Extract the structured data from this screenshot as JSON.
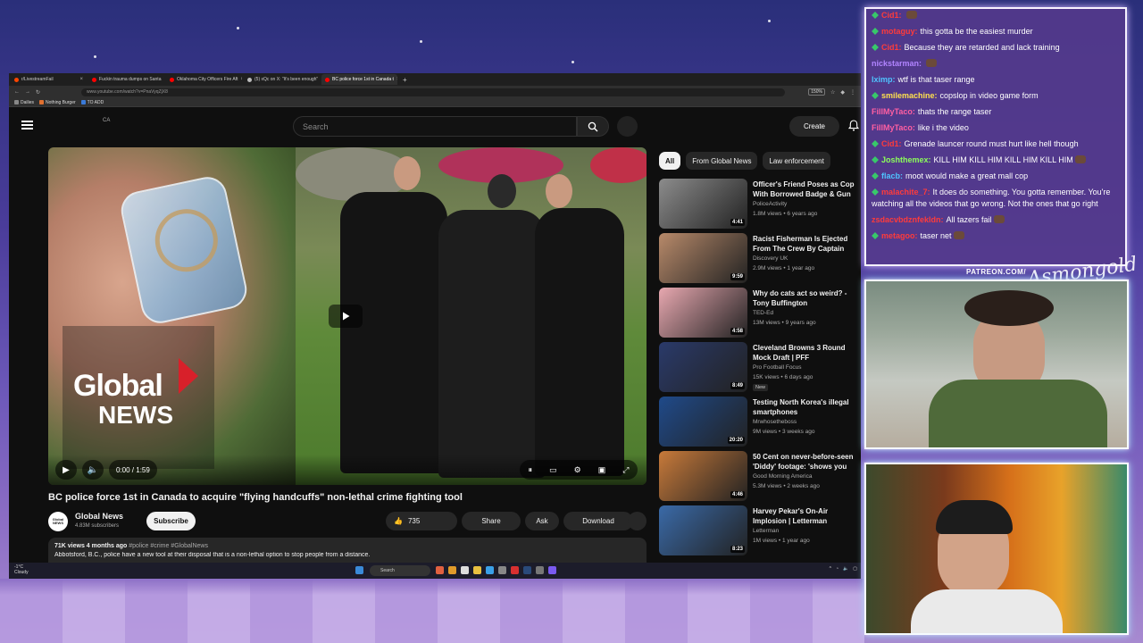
{
  "browser": {
    "tabs": [
      {
        "label": "r/LivestreamFail",
        "color": "#ff4500"
      },
      {
        "label": "Fuckin trauma dumps on Santa",
        "color": "#ff0000"
      },
      {
        "label": "Oklahoma City Officers Fire Aft",
        "color": "#ff0000"
      },
      {
        "label": "(5) xQc on X: \"It's been enough\"",
        "color": "#bbbbbb"
      },
      {
        "label": "BC police force 1st in Canada t",
        "color": "#ff0000"
      }
    ],
    "url": "www.youtube.com/watch?v=PnaVyqZjX8",
    "zoom": "150%",
    "bookmarks": [
      {
        "label": "Dailies",
        "color": "#888888"
      },
      {
        "label": "Nothing Burger",
        "color": "#e07030"
      },
      {
        "label": "TO ADD",
        "color": "#3a7ad8"
      }
    ]
  },
  "youtube": {
    "country": "CA",
    "search_placeholder": "Search",
    "create_label": "Create",
    "player": {
      "time": "0:00 / 1:59",
      "logo_line1": "Global",
      "logo_line2": "NEWS"
    },
    "video": {
      "title": "BC police force 1st in Canada to acquire \"flying handcuffs\" non-lethal crime fighting tool",
      "channel": "Global News",
      "channel_avatar": "Global NEWS",
      "subscribers": "4.83M subscribers",
      "subscribe_label": "Subscribe",
      "likes": "735",
      "share_label": "Share",
      "ask_label": "Ask",
      "download_label": "Download",
      "views_age": "71K views  4 months ago",
      "tags": "#police #crime #GlobalNews",
      "description": "Abbotsford, B.C., police have a new tool at their disposal that is a non-lethal option to stop people from a distance."
    },
    "chips": [
      "All",
      "From Global News",
      "Law enforcement"
    ],
    "recommendations": [
      {
        "title": "Officer's Friend Poses as Cop With Borrowed Badge & Gun T...",
        "channel": "PoliceActivity",
        "views": "1.8M views • 6 years ago",
        "duration": "4:41",
        "thumb": "#8c8c8c",
        "badge": ""
      },
      {
        "title": "Racist Fisherman Is Ejected From The Crew By Captain Ric...",
        "channel": "Discovery UK",
        "views": "2.9M views • 1 year ago",
        "duration": "9:59",
        "thumb": "#b88a6a",
        "badge": ""
      },
      {
        "title": "Why do cats act so weird? - Tony Buffington",
        "channel": "TED-Ed",
        "views": "13M views • 9 years ago",
        "duration": "4:58",
        "thumb": "#e8a8b0",
        "badge": ""
      },
      {
        "title": "Cleveland Browns 3 Round Mock Draft | PFF",
        "channel": "Pro Football Focus",
        "views": "15K views • 6 days ago",
        "duration": "8:49",
        "thumb": "#2a3a6a",
        "badge": "New"
      },
      {
        "title": "Testing North Korea's illegal smartphones",
        "channel": "Mrwhosetheboss",
        "views": "9M views • 3 weeks ago",
        "duration": "20:20",
        "thumb": "#1f4a8a",
        "badge": ""
      },
      {
        "title": "50 Cent on never-before-seen 'Diddy' footage: 'shows you his...",
        "channel": "Good Morning America",
        "views": "5.3M views • 2 weeks ago",
        "duration": "4:46",
        "thumb": "#c87a3a",
        "badge": ""
      },
      {
        "title": "Harvey Pekar's On-Air Implosion | Letterman",
        "channel": "Letterman",
        "views": "1M views • 1 year ago",
        "duration": "8:23",
        "thumb": "#3a6aa8",
        "badge": ""
      }
    ]
  },
  "taskbar": {
    "temp": "-1°C",
    "condition": "Cloudy",
    "search": "Search"
  },
  "chat": [
    {
      "user": "Cid1:",
      "color": "#ff3b3b",
      "text": "",
      "gem": true,
      "emote": true
    },
    {
      "user": "motaguy:",
      "color": "#ff3b3b",
      "text": "this gotta be the easiest murder",
      "gem": true,
      "emote": false
    },
    {
      "user": "Cid1:",
      "color": "#ff3b3b",
      "text": "Because they are retarded and lack training",
      "gem": true,
      "emote": false
    },
    {
      "user": "nickstarman:",
      "color": "#b184ff",
      "text": "",
      "gem": false,
      "emote": true
    },
    {
      "user": "lximp:",
      "color": "#4fc3ff",
      "text": "wtf is that taser range",
      "gem": false,
      "emote": false
    },
    {
      "user": "smilemachine:",
      "color": "#ffe14d",
      "text": "copslop in video game form",
      "gem": true,
      "emote": false
    },
    {
      "user": "FillMyTaco:",
      "color": "#ff5fa2",
      "text": "thats the range taser",
      "gem": false,
      "emote": false
    },
    {
      "user": "FillMyTaco:",
      "color": "#ff5fa2",
      "text": "like i the video",
      "gem": false,
      "emote": false
    },
    {
      "user": "Cid1:",
      "color": "#ff3b3b",
      "text": "Grenade launcer round must hurt like hell though",
      "gem": true,
      "emote": false
    },
    {
      "user": "Joshthemex:",
      "color": "#8cff5a",
      "text": "KILL HIM  KILL HIM  KILL HIM  KILL HIM",
      "gem": true,
      "emote": true
    },
    {
      "user": "flacb:",
      "color": "#4fc3ff",
      "text": "moot would make a great mall cop",
      "gem": true,
      "emote": false
    },
    {
      "user": "malachite_7:",
      "color": "#ff3b3b",
      "text": "It does do something. You gotta remember. You're watching all the videos that go wrong. Not the ones that go right",
      "gem": true,
      "emote": false
    },
    {
      "user": "zsdacvbdznfekldn:",
      "color": "#ff3b3b",
      "text": "All tazers fail",
      "gem": false,
      "emote": true
    },
    {
      "user": "metagoo:",
      "color": "#ff3b3b",
      "text": "taser net",
      "gem": true,
      "emote": true
    }
  ],
  "overlay": {
    "patreon": "PATREON.COM/",
    "signature": "Asmongold"
  }
}
